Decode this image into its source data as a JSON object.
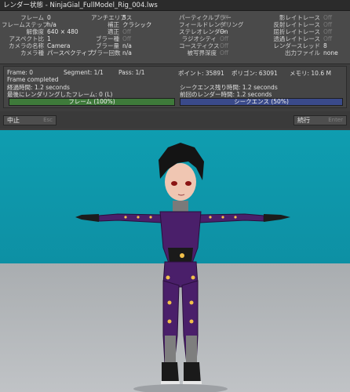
{
  "window": {
    "title": "レンダー状態 - NinjaGial_FullModel_Rig_004.lws"
  },
  "stats": {
    "col1": [
      {
        "label": "フレーム",
        "value": "0"
      },
      {
        "label": "フレームステップ",
        "value": "n/a"
      },
      {
        "label": "解像度",
        "value": "640 × 480"
      },
      {
        "label": "アスペクト比",
        "value": "1"
      },
      {
        "label": "カメラの名称",
        "value": "Camera"
      },
      {
        "label": "カメラ種",
        "value": "パースペクティブ"
      }
    ],
    "col2": [
      {
        "label": "アンチエリアス",
        "value": "5"
      },
      {
        "label": "補正",
        "value": "クラシック"
      },
      {
        "label": "適正",
        "value": "Off"
      },
      {
        "label": "ブラー種",
        "value": "Off"
      },
      {
        "label": "ブラー量",
        "value": "n/a"
      },
      {
        "label": "ブラー回数",
        "value": "n/a"
      }
    ],
    "col3": [
      {
        "label": "パーティクルブラー",
        "value": "Off"
      },
      {
        "label": "フィールドレンダリング",
        "value": "Off"
      },
      {
        "label": "ステレオレンダー",
        "value": "On"
      },
      {
        "label": "ラジオシティ",
        "value": "Off"
      },
      {
        "label": "コースティクス",
        "value": "Off"
      },
      {
        "label": "被写界深度",
        "value": "Off"
      }
    ],
    "col4": [
      {
        "label": "影レイトレース",
        "value": "Off"
      },
      {
        "label": "反射レイトレース",
        "value": "Off"
      },
      {
        "label": "屈折レイトレース",
        "value": "Off"
      },
      {
        "label": "透過レイトレース",
        "value": "Off"
      },
      {
        "label": "レンダースレッド",
        "value": "8"
      },
      {
        "label": "出力ファイル",
        "value": "none"
      }
    ]
  },
  "progress": {
    "frame": "Frame: 0",
    "segment": "Segment: 1/1",
    "pass": "Pass: 1/1",
    "points": "ポイント: 35891",
    "polygons": "ポリゴン: 63091",
    "memory": "メモリ: 10.6 M",
    "status": "Frame completed",
    "elapsed": "経過時間: 1.2 seconds",
    "last_frame": "最後にレンダリングしたフレーム: 0 (L)",
    "seq_remaining": "シークエンス残り時間: 1.2 seconds",
    "prev_render": "前回のレンダー時間: 1.2 seconds",
    "frame_bar_label": "フレーム (100%)",
    "frame_bar_value": 1.0,
    "seq_bar_label": "シークエンス (50%)",
    "seq_bar_value": 0.5
  },
  "buttons": {
    "abort": "中止",
    "abort_key": "Esc",
    "continue": "続行",
    "continue_key": "Enter"
  },
  "colors": {
    "frame_bar": "#3e7a3a",
    "seq_bar": "#3a4a8a",
    "sky": "#0f9db0",
    "floor": "#b8bbbe",
    "suit": "#4a1f6a"
  }
}
